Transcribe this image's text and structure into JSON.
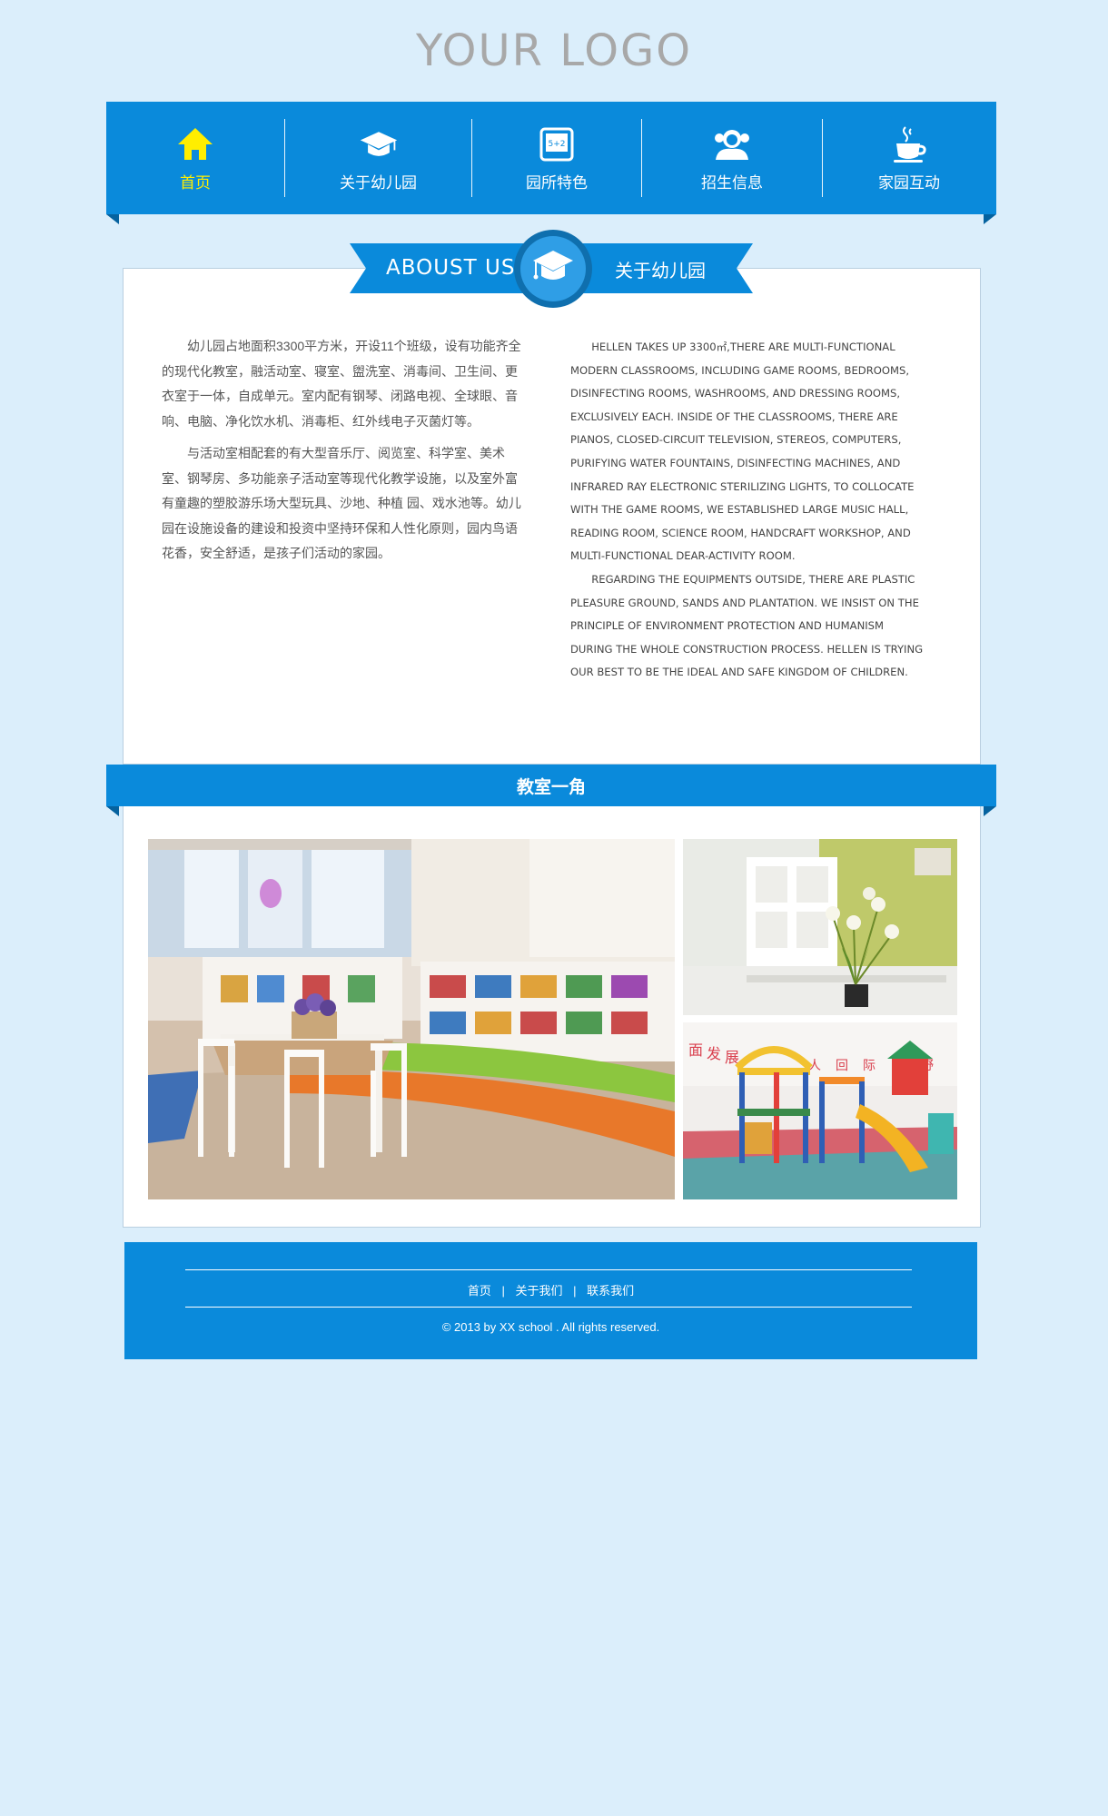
{
  "logo": {
    "text": "YOUR LOGO"
  },
  "nav": {
    "items": [
      {
        "label": "首页",
        "icon": "home-icon",
        "active": true
      },
      {
        "label": "关于幼儿园",
        "icon": "graduation-cap-icon"
      },
      {
        "label": "园所特色",
        "icon": "chalkboard-icon"
      },
      {
        "label": "招生信息",
        "icon": "people-icon"
      },
      {
        "label": "家园互动",
        "icon": "coffee-cup-icon"
      }
    ]
  },
  "about": {
    "ribbon_en": "ABOUST US",
    "ribbon_cn": "关于幼儿园",
    "badge_icon": "graduation-cap-icon",
    "cn_paragraphs": [
      "幼儿园占地面积3300平方米，开设11个班级，设有功能齐全的现代化教室，融活动室、寝室、盥洗室、消毒间、卫生间、更衣室于一体，自成单元。室内配有钢琴、闭路电视、全球眼、音响、电脑、净化饮水机、消毒柜、红外线电子灭菌灯等。",
      "与活动室相配套的有大型音乐厅、阅览室、科学室、美术室、钢琴房、多功能亲子活动室等现代化教学设施，以及室外富有童趣的塑胶游乐场大型玩具、沙地、种植 园、戏水池等。幼儿园在设施设备的建设和投资中坚持环保和人性化原则，园内鸟语花香，安全舒适，是孩子们活动的家园。"
    ],
    "en_paragraphs": [
      "HELLEN TAKES UP 3300㎡,THERE ARE MULTI-FUNCTIONAL MODERN CLASSROOMS, INCLUDING GAME ROOMS, BEDROOMS, DISINFECTING ROOMS, WASHROOMS, AND DRESSING ROOMS, EXCLUSIVELY EACH. INSIDE OF THE CLASSROOMS, THERE ARE PIANOS, CLOSED-CIRCUIT TELEVISION, STEREOS, COMPUTERS, PURIFYING WATER FOUNTAINS, DISINFECTING MACHINES, AND INFRARED RAY ELECTRONIC STERILIZING LIGHTS, TO COLLOCATE WITH THE GAME ROOMS, WE ESTABLISHED LARGE MUSIC HALL, READING ROOM, SCIENCE ROOM, HANDCRAFT WORKSHOP, AND MULTI-FUNCTIONAL DEAR-ACTIVITY ROOM.",
      "REGARDING THE EQUIPMENTS OUTSIDE, THERE ARE PLASTIC PLEASURE GROUND, SANDS AND PLANTATION. WE INSIST ON THE PRINCIPLE OF ENVIRONMENT PROTECTION AND HUMANISM DURING THE WHOLE CONSTRUCTION PROCESS. HELLEN IS TRYING OUR BEST TO BE THE IDEAL AND SAFE KINGDOM OF CHILDREN."
    ]
  },
  "gallery": {
    "title": "教室一角",
    "photo_labels": {
      "playground_signs": [
        "面",
        "发",
        "展",
        "人",
        "回",
        "际",
        "野"
      ]
    }
  },
  "footer": {
    "links": [
      "首页",
      "关于我们",
      "联系我们"
    ],
    "separator": "|",
    "copyright": "© 2013 by XX school  . All rights reserved."
  },
  "colors": {
    "background": "#dbeefb",
    "brand_blue": "#0a8adb",
    "fold_blue": "#05629f",
    "active_nav": "#ffee00",
    "logo_gray": "#a8a8a8"
  }
}
